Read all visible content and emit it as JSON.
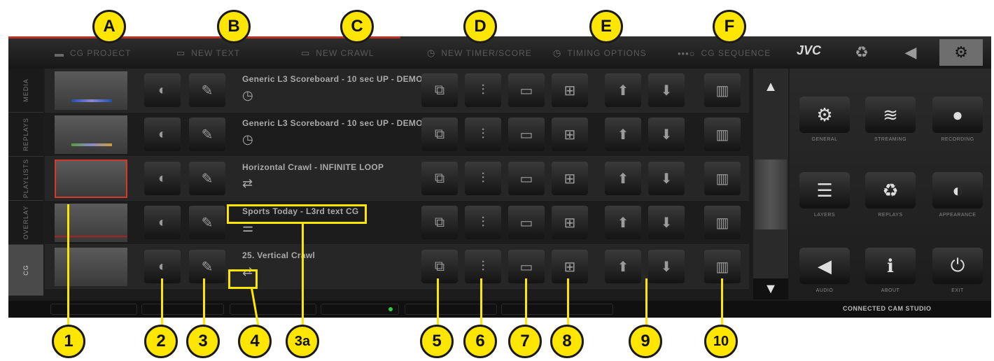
{
  "top_menu": [
    {
      "label": "CG PROJECT",
      "icon": "folder-icon"
    },
    {
      "label": "NEW TEXT",
      "icon": "text-icon"
    },
    {
      "label": "NEW CRAWL",
      "icon": "crawl-icon"
    },
    {
      "label": "NEW TIMER/SCORE",
      "icon": "timer-icon"
    },
    {
      "label": "TIMING OPTIONS",
      "icon": "stopwatch-icon"
    },
    {
      "label": "CG SEQUENCE",
      "icon": "sequence-icon"
    }
  ],
  "brand": "JVC",
  "left_tabs": [
    "MEDIA",
    "REPLAYS",
    "PLAYLISTS",
    "OVERLAY",
    "CG"
  ],
  "rows": [
    {
      "title": "Generic L3 Scoreboard - 10 sec UP - DEMO",
      "type_icon": "timer-icon",
      "selected": false
    },
    {
      "title": "Generic L3 Scoreboard - 10 sec UP - DEMO",
      "type_icon": "timer-icon",
      "selected": false
    },
    {
      "title": "Horizontal Crawl - INFINITE LOOP",
      "type_icon": "crawl-icon",
      "selected": true
    },
    {
      "title": "Sports Today - L3rd text CG",
      "type_icon": "text-icon",
      "selected": false
    },
    {
      "title": "25. Vertical Crawl",
      "type_icon": "crawl-icon",
      "selected": false
    }
  ],
  "settings_tiles": [
    {
      "label": "GENERAL",
      "icon": "gear-icon"
    },
    {
      "label": "STREAMING",
      "icon": "wifi-icon"
    },
    {
      "label": "RECORDING",
      "icon": "record-icon"
    },
    {
      "label": "LAYERS",
      "icon": "layers-icon"
    },
    {
      "label": "REPLAYS",
      "icon": "replay-icon"
    },
    {
      "label": "APPEARANCE",
      "icon": "eye-icon"
    },
    {
      "label": "AUDIO",
      "icon": "speaker-icon"
    },
    {
      "label": "ABOUT",
      "icon": "info-icon"
    },
    {
      "label": "EXIT",
      "icon": "power-icon"
    }
  ],
  "status_title": "CONNECTED CAM STUDIO",
  "callouts_top": [
    "A",
    "B",
    "C",
    "D",
    "E",
    "F"
  ],
  "callouts_bottom": [
    "1",
    "2",
    "3",
    "4",
    "3a",
    "5",
    "6",
    "7",
    "8",
    "9",
    "10"
  ]
}
